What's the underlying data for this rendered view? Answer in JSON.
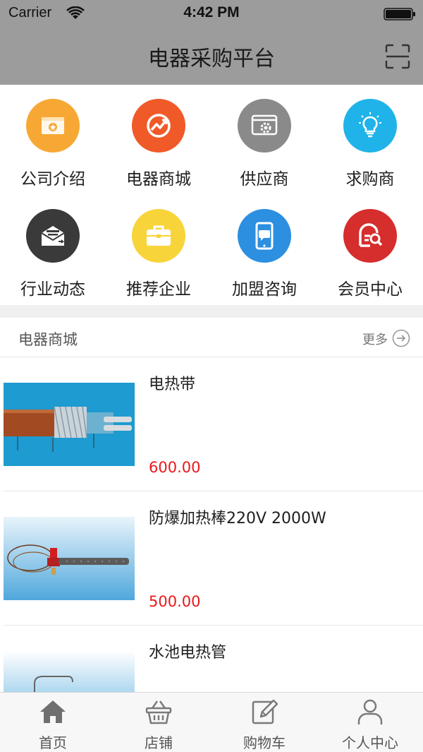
{
  "status_bar": {
    "carrier": "Carrier",
    "time": "4:42 PM"
  },
  "nav": {
    "title": "电器采购平台",
    "right_icon": "scan-icon"
  },
  "grid": [
    {
      "label": "公司介绍",
      "icon": "company-intro-icon",
      "color": "#f7a834"
    },
    {
      "label": "电器商城",
      "icon": "mall-icon",
      "color": "#f05a28"
    },
    {
      "label": "供应商",
      "icon": "supplier-icon",
      "color": "#8a8a8a"
    },
    {
      "label": "求购商",
      "icon": "buyer-icon",
      "color": "#1fb3ea"
    },
    {
      "label": "行业动态",
      "icon": "news-icon",
      "color": "#3a3a3a"
    },
    {
      "label": "推荐企业",
      "icon": "briefcase-icon",
      "color": "#f7d43a"
    },
    {
      "label": "加盟咨询",
      "icon": "consult-icon",
      "color": "#2c8fe0"
    },
    {
      "label": "会员中心",
      "icon": "member-icon",
      "color": "#d62d2d"
    }
  ],
  "section": {
    "title": "电器商城",
    "more_label": "更多"
  },
  "products": [
    {
      "name": "电热带",
      "price": "600.00"
    },
    {
      "name": "防爆加热棒220V 2000W",
      "price": "500.00"
    },
    {
      "name": "水池电热管",
      "price": ""
    }
  ],
  "tabbar": [
    {
      "label": "首页",
      "icon": "home-icon",
      "active": true
    },
    {
      "label": "店铺",
      "icon": "basket-icon",
      "active": false
    },
    {
      "label": "购物车",
      "icon": "edit-icon",
      "active": false
    },
    {
      "label": "个人中心",
      "icon": "user-icon",
      "active": false
    }
  ],
  "colors": {
    "nav_bg": "#9c9c9c",
    "price": "#e8191b",
    "tab_active": "#6f6f6f"
  }
}
